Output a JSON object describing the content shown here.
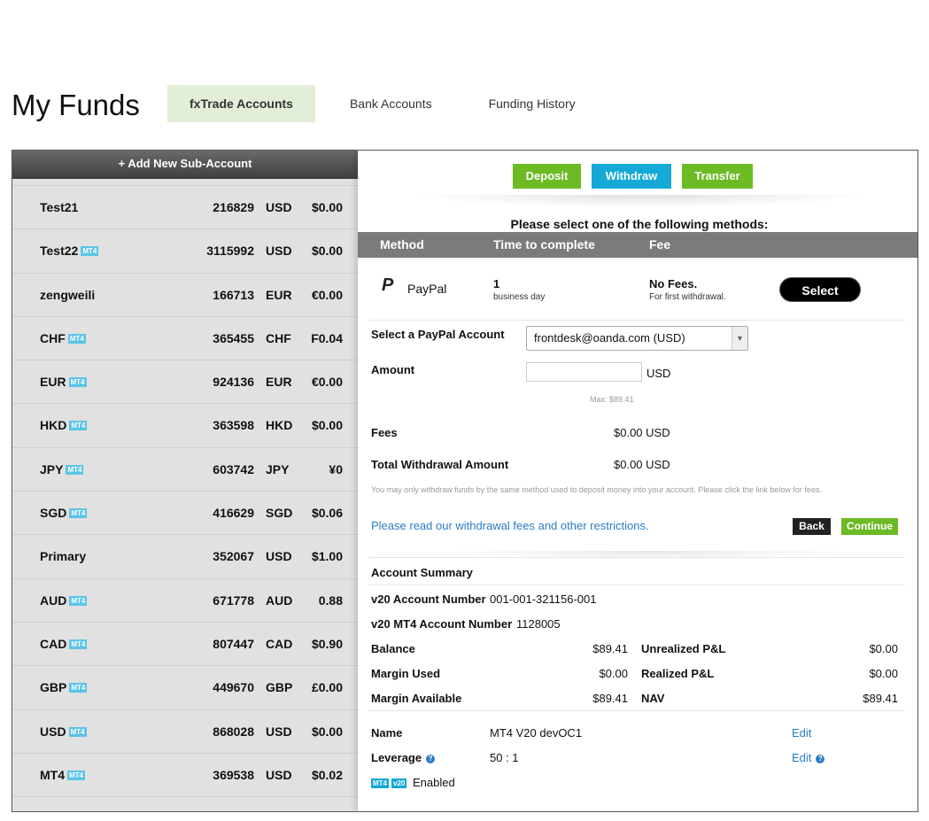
{
  "page": {
    "title": "My Funds"
  },
  "tabs": [
    {
      "label": "fxTrade Accounts",
      "active": true
    },
    {
      "label": "Bank Accounts",
      "active": false
    },
    {
      "label": "Funding History",
      "active": false
    }
  ],
  "sidebar": {
    "add_label": "+ Add New Sub-Account",
    "accounts": [
      {
        "name": "Test21",
        "badge": "",
        "number": "216829",
        "currency": "USD",
        "balance": "$0.00"
      },
      {
        "name": "Test22",
        "badge": "MT4",
        "number": "3115992",
        "currency": "USD",
        "balance": "$0.00"
      },
      {
        "name": "zengweili",
        "badge": "",
        "number": "166713",
        "currency": "EUR",
        "balance": "€0.00"
      },
      {
        "name": "CHF",
        "badge": "MT4",
        "number": "365455",
        "currency": "CHF",
        "balance": "F0.04"
      },
      {
        "name": "EUR",
        "badge": "MT4",
        "number": "924136",
        "currency": "EUR",
        "balance": "€0.00"
      },
      {
        "name": "HKD",
        "badge": "MT4",
        "number": "363598",
        "currency": "HKD",
        "balance": "$0.00"
      },
      {
        "name": "JPY",
        "badge": "MT4",
        "number": "603742",
        "currency": "JPY",
        "balance": "¥0"
      },
      {
        "name": "SGD",
        "badge": "MT4",
        "number": "416629",
        "currency": "SGD",
        "balance": "$0.06"
      },
      {
        "name": "Primary",
        "badge": "",
        "number": "352067",
        "currency": "USD",
        "balance": "$1.00"
      },
      {
        "name": "AUD",
        "badge": "MT4",
        "number": "671778",
        "currency": "AUD",
        "balance": "0.88"
      },
      {
        "name": "CAD",
        "badge": "MT4",
        "number": "807447",
        "currency": "CAD",
        "balance": "$0.90"
      },
      {
        "name": "GBP",
        "badge": "MT4",
        "number": "449670",
        "currency": "GBP",
        "balance": "£0.00"
      },
      {
        "name": "USD",
        "badge": "MT4",
        "number": "868028",
        "currency": "USD",
        "balance": "$0.00"
      },
      {
        "name": "MT4",
        "badge": "MT4",
        "number": "369538",
        "currency": "USD",
        "balance": "$0.02"
      }
    ]
  },
  "actions": {
    "deposit": "Deposit",
    "withdraw": "Withdraw",
    "transfer": "Transfer"
  },
  "methods": {
    "heading": "Please select one of the following methods:",
    "col_method": "Method",
    "col_time": "Time to complete",
    "col_fee": "Fee",
    "paypal": {
      "label": "PayPal",
      "time_value": "1",
      "time_unit": "business day",
      "fee": "No Fees.",
      "fee_note": "For first withdrawal.",
      "select_label": "Select"
    }
  },
  "form": {
    "account_label": "Select a PayPal Account",
    "account_value": "frontdesk@oanda.com (USD)",
    "amount_label": "Amount",
    "amount_value": "",
    "amount_currency": "USD",
    "max_note": "Max: $89.41",
    "fees_label": "Fees",
    "fees_value": "$0.00 USD",
    "total_label": "Total Withdrawal Amount",
    "total_value": "$0.00 USD",
    "disclaimer": "You may only withdraw funds by the same method used to deposit money into your account. Please click the link below for fees.",
    "fees_link": "Please read our withdrawal fees and other restrictions.",
    "back_label": "Back",
    "continue_label": "Continue"
  },
  "summary": {
    "title": "Account Summary",
    "v20_label": "v20 Account Number",
    "v20_value": "001-001-321156-001",
    "mt4_label": "v20 MT4 Account Number",
    "mt4_value": "1128005",
    "balance_label": "Balance",
    "balance_value": "$89.41",
    "margin_used_label": "Margin Used",
    "margin_used_value": "$0.00",
    "margin_avail_label": "Margin Available",
    "margin_avail_value": "$89.41",
    "unrealized_label": "Unrealized P&L",
    "unrealized_value": "$0.00",
    "realized_label": "Realized P&L",
    "realized_value": "$0.00",
    "nav_label": "NAV",
    "nav_value": "$89.41",
    "name_label": "Name",
    "name_value": "MT4 V20 devOC1",
    "leverage_label": "Leverage",
    "leverage_value": "50 : 1",
    "edit_label": "Edit",
    "badge_mt4": "MT4",
    "badge_v20": "v20",
    "enabled_label": "Enabled"
  },
  "colors": {
    "green": "#6cba24",
    "blue": "#14a9d6",
    "link": "#2a7cc6",
    "tab_active": "#e3eed9"
  }
}
